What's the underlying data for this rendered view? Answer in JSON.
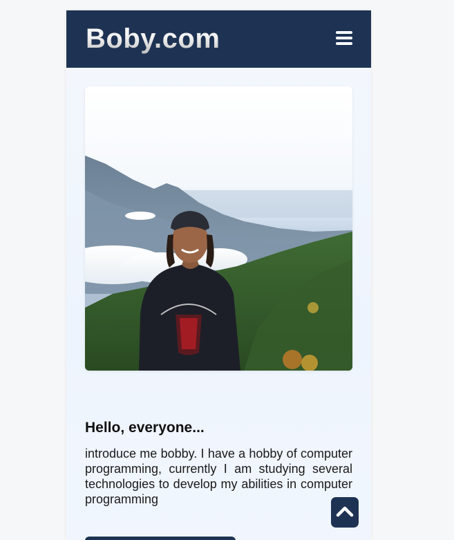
{
  "header": {
    "brand_name": "Boby",
    "brand_suffix": ".com",
    "menu_icon": "hamburger-menu-icon"
  },
  "hero": {
    "photo_description": "profile-photo"
  },
  "about": {
    "greeting": "Hello, everyone...",
    "intro": "introduce me bobby. I have a hobby of computer programming, currently I am studying several technologies to develop my abilities in computer programming"
  },
  "scroll_top": {
    "icon": "chevron-up-icon"
  },
  "colors": {
    "navbar": "#1e3353",
    "accent": "#1e3353",
    "text": "#111111",
    "background": "#f6f7f8"
  }
}
